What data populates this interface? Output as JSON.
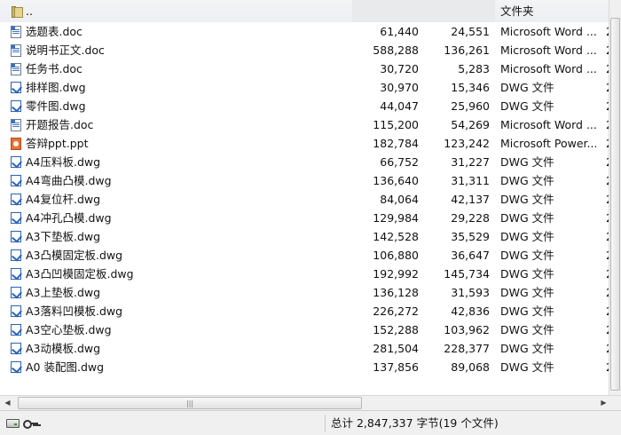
{
  "file_list": {
    "parent": {
      "name": "..",
      "size": "",
      "packed": "",
      "type": "文件夹",
      "icon": "folder-up-icon"
    },
    "rows": [
      {
        "name": "选题表.doc",
        "size": "61,440",
        "packed": "24,551",
        "type": "Microsoft Word ...",
        "more": "2",
        "icon": "word-doc-icon"
      },
      {
        "name": "说明书正文.doc",
        "size": "588,288",
        "packed": "136,261",
        "type": "Microsoft Word ...",
        "more": "2",
        "icon": "word-doc-icon"
      },
      {
        "name": "任务书.doc",
        "size": "30,720",
        "packed": "5,283",
        "type": "Microsoft Word ...",
        "more": "2",
        "icon": "word-doc-icon"
      },
      {
        "name": "排样图.dwg",
        "size": "30,970",
        "packed": "15,346",
        "type": "DWG 文件",
        "more": "2",
        "icon": "dwg-file-icon"
      },
      {
        "name": "零件图.dwg",
        "size": "44,047",
        "packed": "25,960",
        "type": "DWG 文件",
        "more": "2",
        "icon": "dwg-file-icon"
      },
      {
        "name": "开题报告.doc",
        "size": "115,200",
        "packed": "54,269",
        "type": "Microsoft Word ...",
        "more": "2",
        "icon": "word-doc-icon"
      },
      {
        "name": "答辩ppt.ppt",
        "size": "182,784",
        "packed": "123,242",
        "type": "Microsoft Power...",
        "more": "2",
        "icon": "powerpoint-icon"
      },
      {
        "name": "A4压料板.dwg",
        "size": "66,752",
        "packed": "31,227",
        "type": "DWG 文件",
        "more": "2",
        "icon": "dwg-file-icon"
      },
      {
        "name": "A4弯曲凸模.dwg",
        "size": "136,640",
        "packed": "31,311",
        "type": "DWG 文件",
        "more": "2",
        "icon": "dwg-file-icon"
      },
      {
        "name": "A4复位杆.dwg",
        "size": "84,064",
        "packed": "42,137",
        "type": "DWG 文件",
        "more": "2",
        "icon": "dwg-file-icon"
      },
      {
        "name": "A4冲孔凸模.dwg",
        "size": "129,984",
        "packed": "29,228",
        "type": "DWG 文件",
        "more": "2",
        "icon": "dwg-file-icon"
      },
      {
        "name": "A3下垫板.dwg",
        "size": "142,528",
        "packed": "35,529",
        "type": "DWG 文件",
        "more": "2",
        "icon": "dwg-file-icon"
      },
      {
        "name": "A3凸模固定板.dwg",
        "size": "106,880",
        "packed": "36,647",
        "type": "DWG 文件",
        "more": "2",
        "icon": "dwg-file-icon"
      },
      {
        "name": "A3凸凹模固定板.dwg",
        "size": "192,992",
        "packed": "145,734",
        "type": "DWG 文件",
        "more": "2",
        "icon": "dwg-file-icon"
      },
      {
        "name": "A3上垫板.dwg",
        "size": "136,128",
        "packed": "31,593",
        "type": "DWG 文件",
        "more": "2",
        "icon": "dwg-file-icon"
      },
      {
        "name": "A3落料凹模板.dwg",
        "size": "226,272",
        "packed": "42,836",
        "type": "DWG 文件",
        "more": "2",
        "icon": "dwg-file-icon"
      },
      {
        "name": "A3空心垫板.dwg",
        "size": "152,288",
        "packed": "103,962",
        "type": "DWG 文件",
        "more": "2",
        "icon": "dwg-file-icon"
      },
      {
        "name": "A3动模板.dwg",
        "size": "281,504",
        "packed": "228,377",
        "type": "DWG 文件",
        "more": "2",
        "icon": "dwg-file-icon"
      },
      {
        "name": "A0 装配图.dwg",
        "size": "137,856",
        "packed": "89,068",
        "type": "DWG 文件",
        "more": "2",
        "icon": "dwg-file-icon"
      }
    ]
  },
  "hscroll": {
    "left_arrow": "◀",
    "right_arrow": "▶",
    "grip": "|||"
  },
  "status": {
    "summary": "总计 2,847,337 字节(19 个文件)",
    "icons": [
      "drive-icon",
      "key-icon"
    ]
  }
}
